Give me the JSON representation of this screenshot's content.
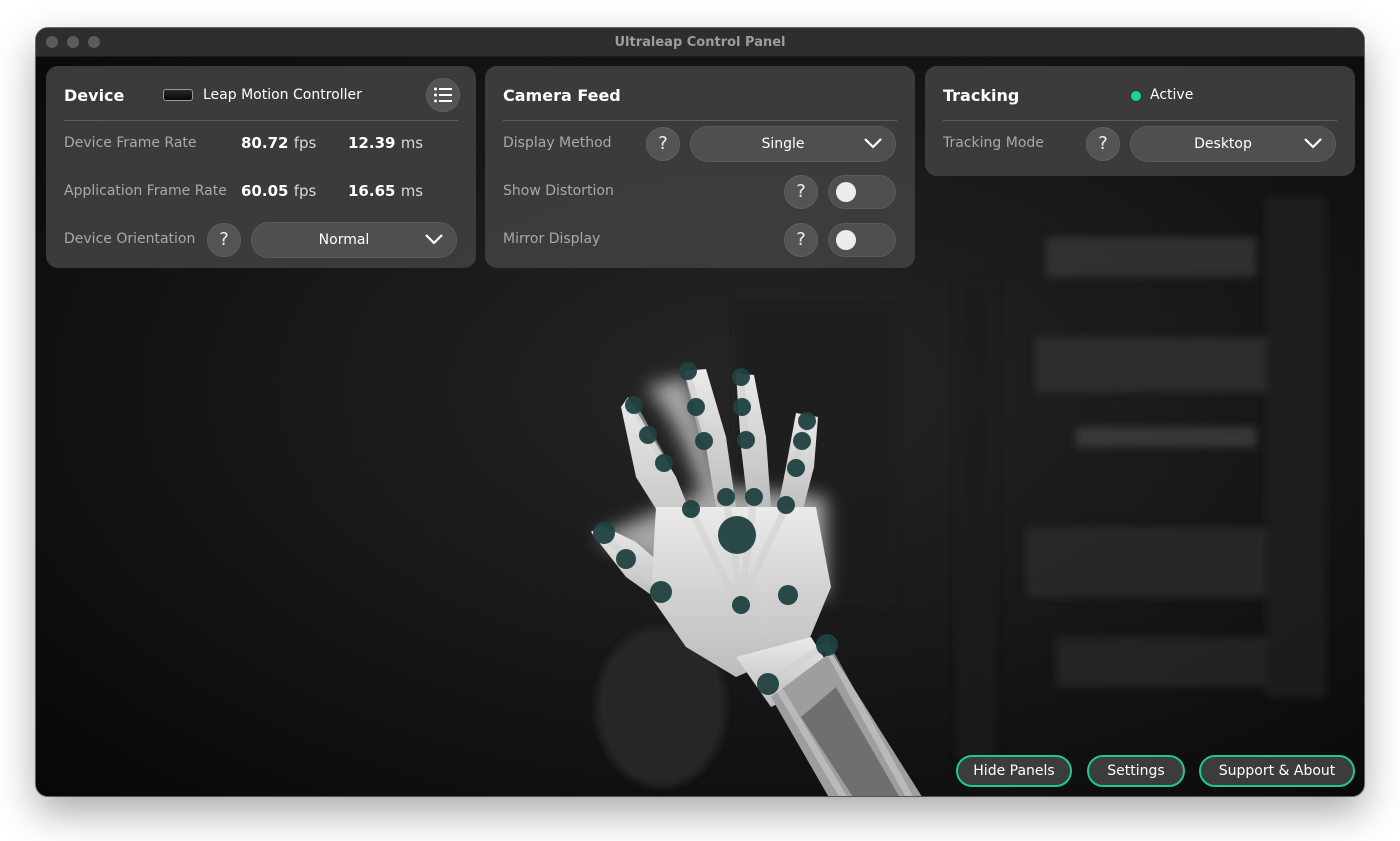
{
  "window": {
    "title": "Ultraleap Control Panel"
  },
  "device": {
    "title": "Device",
    "device_name": "Leap Motion Controller",
    "menu_icon": "list-icon",
    "rows": {
      "device_frame_rate": {
        "label": "Device Frame Rate",
        "fps": "80.72",
        "fps_unit": "fps",
        "ms": "12.39",
        "ms_unit": "ms"
      },
      "application_frame_rate": {
        "label": "Application Frame Rate",
        "fps": "60.05",
        "fps_unit": "fps",
        "ms": "16.65",
        "ms_unit": "ms"
      },
      "device_orientation": {
        "label": "Device Orientation",
        "help": "?",
        "value": "Normal"
      }
    }
  },
  "camera_feed": {
    "title": "Camera Feed",
    "display_method": {
      "label": "Display Method",
      "help": "?",
      "value": "Single"
    },
    "show_distortion": {
      "label": "Show Distortion",
      "help": "?",
      "on": false
    },
    "mirror_display": {
      "label": "Mirror Display",
      "help": "?",
      "on": false
    }
  },
  "tracking": {
    "title": "Tracking",
    "status": "Active",
    "status_color": "#1ed49a",
    "tracking_mode": {
      "label": "Tracking Mode",
      "help": "?",
      "value": "Desktop"
    }
  },
  "footer": {
    "hide_panels": "Hide Panels",
    "settings": "Settings",
    "support_about": "Support & About",
    "accent_color": "#1dc79a"
  }
}
